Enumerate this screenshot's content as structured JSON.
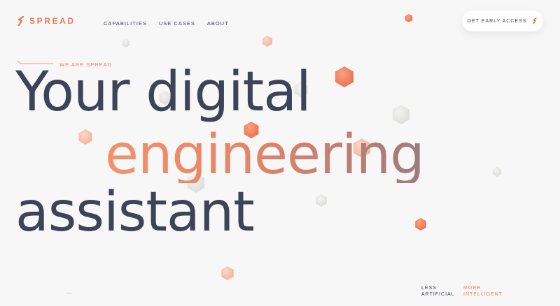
{
  "brand": {
    "name": "SPREAD",
    "accent": "#ec7d57",
    "text": "#3d4457"
  },
  "nav": {
    "items": [
      {
        "label": "CAPABILITIES"
      },
      {
        "label": "USE CASES"
      },
      {
        "label": "ABOUT"
      }
    ]
  },
  "cta": {
    "label": "GET EARLY ACCESS",
    "icon": "spread-mark-icon"
  },
  "hero": {
    "eyebrow": "WE ARE SPREAD",
    "line1": "Your digital",
    "line2": "engineering",
    "line3": "assistant"
  },
  "tagline": {
    "left_line1": "LESS",
    "left_line2": "ARTIFICIAL",
    "right_line1": "MORE",
    "right_line2": "INTELLIGENT"
  },
  "decor": {
    "colors": {
      "orange": "#f08b66",
      "peach": "#f6c3ae",
      "grey": "#e3e3e0"
    }
  }
}
